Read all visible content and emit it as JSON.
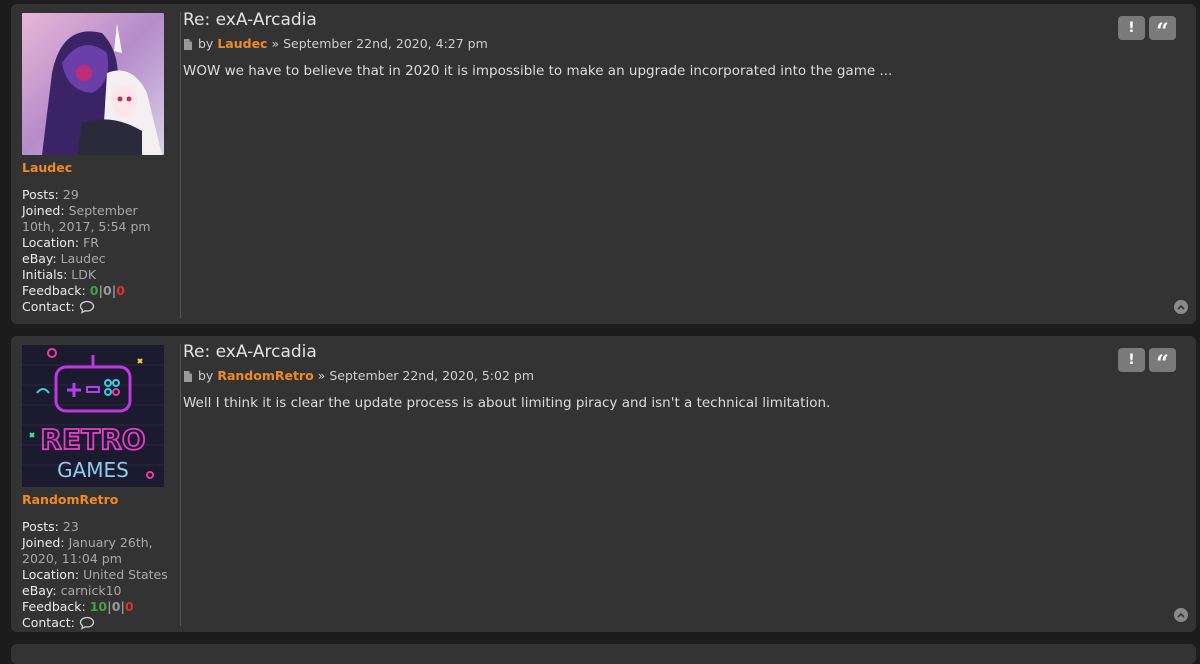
{
  "posts": [
    {
      "title": "Re: exA-Arcadia",
      "by": "by",
      "author": "Laudec",
      "separator": "»",
      "date": "September 22nd, 2020, 4:27 pm",
      "content": "WOW we have to believe that in 2020 it is impossible to make an upgrade incorporated into the game ...",
      "profile": {
        "username": "Laudec",
        "avatar_icon": "anime-avatar",
        "posts_label": "Posts:",
        "posts": "29",
        "joined_label": "Joined:",
        "joined": "September 10th, 2017, 5:54 pm",
        "location_label": "Location:",
        "location": "FR",
        "ebay_label": "eBay:",
        "ebay": "Laudec",
        "initials_label": "Initials:",
        "initials": "LDK",
        "feedback_label": "Feedback:",
        "feedback_pos": "0",
        "feedback_sep": "|",
        "feedback_neu": "0",
        "feedback_neg": "0",
        "contact_label": "Contact:"
      },
      "report_label": "!",
      "quote_label": "“"
    },
    {
      "title": "Re: exA-Arcadia",
      "by": "by",
      "author": "RandomRetro",
      "separator": "»",
      "date": "September 22nd, 2020, 5:02 pm",
      "content": "Well I think it is clear the update process is about limiting piracy and isn't a technical limitation.",
      "profile": {
        "username": "RandomRetro",
        "avatar_icon": "retro-games-avatar",
        "avatar_text_1": "RETRO",
        "avatar_text_2": "GAMES",
        "posts_label": "Posts:",
        "posts": "23",
        "joined_label": "Joined:",
        "joined": "January 26th, 2020, 11:04 pm",
        "location_label": "Location:",
        "location": "United States",
        "ebay_label": "eBay:",
        "ebay": "carnick10",
        "feedback_label": "Feedback:",
        "feedback_pos": "10",
        "feedback_sep": "|",
        "feedback_neu": "0",
        "feedback_neg": "0",
        "contact_label": "Contact:"
      },
      "report_label": "!",
      "quote_label": "“"
    }
  ],
  "colors": {
    "background": "#1c1c1c",
    "panel": "#333333",
    "username": "#f08a24",
    "feedback_positive": "#3ea63e",
    "feedback_negative": "#e0302a"
  }
}
